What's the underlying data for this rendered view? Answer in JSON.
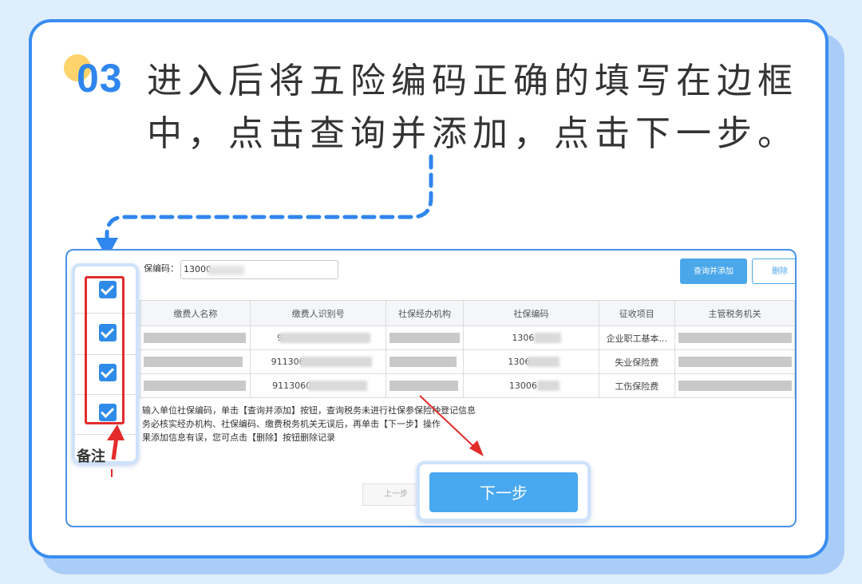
{
  "header": {
    "step_number": "03",
    "instruction_line1": "进入后将五险编码正确的填写在边框",
    "instruction_line2": "中，点击查询并添加，点击下一步。"
  },
  "form": {
    "code_label": "保编码：",
    "code_value": "13000"
  },
  "toolbar": {
    "query_add_label": "查询并添加",
    "delete_label": "删除"
  },
  "table": {
    "columns": [
      "缴费人名称",
      "缴费人识别号",
      "社保经办机构",
      "社保编码",
      "征收项目",
      "主管税务机关"
    ],
    "rows": [
      {
        "taxpayer_id": "9",
        "social_code": "1306",
        "item": "企业职工基本..."
      },
      {
        "taxpayer_id": "911306",
        "social_code": "1306",
        "item": "失业保险费"
      },
      {
        "taxpayer_id": "9113060",
        "social_code": "13006",
        "item": "工伤保险费"
      }
    ]
  },
  "notes": [
    "输入单位社保编码，单击【查询并添加】按钮，查询税务未进行社保参保险种登记信息",
    "务必核实经办机构、社保编码、缴费税务机关无误后，再单击【下一步】操作",
    "果添加信息有误，您可点击【删除】按钮删除记录"
  ],
  "footer": {
    "prev_label": "上一步",
    "next_label": "下一步",
    "remark_label": "备注"
  },
  "colors": {
    "accent": "#2f86ee",
    "highlight": "#e32b2b",
    "button": "#48a8f0"
  }
}
